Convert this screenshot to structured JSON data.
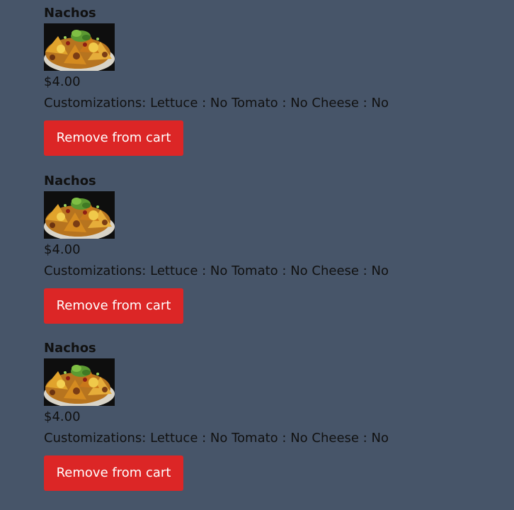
{
  "theme": {
    "background": "#475569",
    "text": "#111111",
    "button": "#dc2626",
    "button_text": "#ffffff"
  },
  "cart": {
    "items": [
      {
        "name": "Nachos",
        "image_icon": "nachos-photo",
        "price": "$4.00",
        "customizations_label": "Customizations:",
        "customizations": "Lettuce : No Tomato : No Cheese : No",
        "remove_label": "Remove from cart"
      },
      {
        "name": "Nachos",
        "image_icon": "nachos-photo",
        "price": "$4.00",
        "customizations_label": "Customizations:",
        "customizations": "Lettuce : No Tomato : No Cheese : No",
        "remove_label": "Remove from cart"
      },
      {
        "name": "Nachos",
        "image_icon": "nachos-photo",
        "price": "$4.00",
        "customizations_label": "Customizations:",
        "customizations": "Lettuce : No Tomato : No Cheese : No",
        "remove_label": "Remove from cart"
      }
    ]
  }
}
